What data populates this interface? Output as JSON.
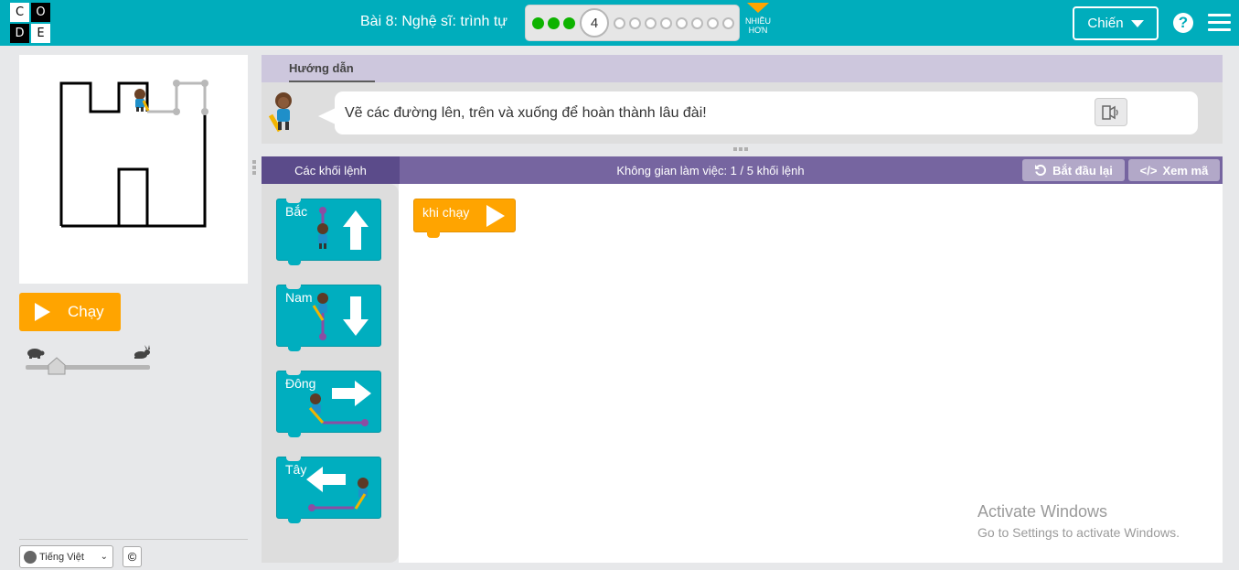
{
  "header": {
    "logo_letters": [
      "C",
      "O",
      "D",
      "E"
    ],
    "lesson_title": "Bài 8: Nghệ sĩ: trình tự",
    "progress": {
      "completed": 3,
      "current_level": "4",
      "remaining": 8
    },
    "more_label_1": "NHIỀU",
    "more_label_2": "HƠN",
    "user_name": "Chiến",
    "help_symbol": "?"
  },
  "colors": {
    "header": "#00adbc",
    "run_button": "#ffa400",
    "block": "#00aebf",
    "workspace_header": "#7665a0",
    "progress_done": "#0eb300"
  },
  "left": {
    "run_label": "Chạy",
    "speed_level": 0.18,
    "slow_icon": "turtle-icon",
    "fast_icon": "rabbit-icon",
    "language": "Tiếng Việt",
    "copyright_symbol": "©"
  },
  "instructions": {
    "tab_label": "Hướng dẫn",
    "text": "Vẽ các đường lên, trên và xuống để hoàn thành lâu đài!",
    "speaker_icon": "speaker-icon"
  },
  "workspace": {
    "toolbox_title": "Các khối lệnh",
    "title": "Không gian làm việc: 1 / 5 khối lệnh",
    "reset_label": "Bắt đầu lại",
    "code_label": "Xem mã",
    "when_run_label": "khi chạy"
  },
  "blocks": [
    {
      "label": "Bắc",
      "direction": "north"
    },
    {
      "label": "Nam",
      "direction": "south"
    },
    {
      "label": "Đông",
      "direction": "east"
    },
    {
      "label": "Tây",
      "direction": "west"
    }
  ],
  "watermark": {
    "line1": "Activate Windows",
    "line2": "Go to Settings to activate Windows."
  }
}
